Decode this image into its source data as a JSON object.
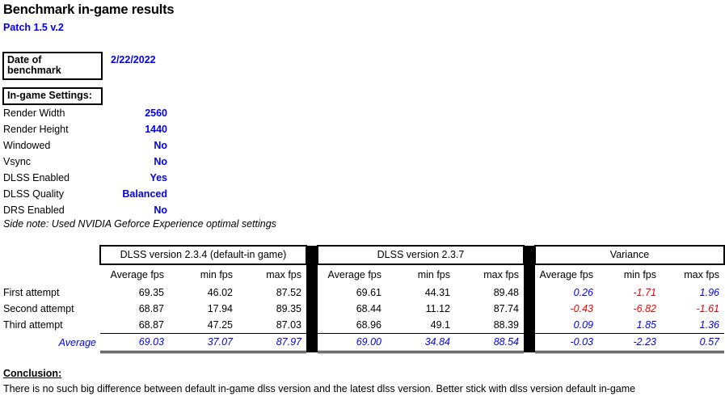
{
  "header": {
    "title": "Benchmark in-game results",
    "subtitle": "Patch 1.5 v.2"
  },
  "date": {
    "label": "Date of benchmark",
    "value": "2/22/2022"
  },
  "settings": {
    "heading": "In-game Settings:",
    "items": [
      {
        "name": "Render Width",
        "value": "2560"
      },
      {
        "name": "Render Height",
        "value": "1440"
      },
      {
        "name": "Windowed",
        "value": "No"
      },
      {
        "name": "Vsync",
        "value": "No"
      },
      {
        "name": "DLSS Enabled",
        "value": "Yes"
      },
      {
        "name": "DLSS Quality",
        "value": "Balanced"
      },
      {
        "name": "DRS Enabled",
        "value": "No"
      }
    ],
    "side_note": "Side note: Used NVIDIA Geforce Experience optimal settings"
  },
  "table": {
    "groups": [
      {
        "title": "DLSS version 2.3.4 (default-in game)"
      },
      {
        "title": "DLSS version 2.3.7"
      },
      {
        "title": "Variance"
      }
    ],
    "column_headers": [
      "Average fps",
      "min fps",
      "max fps"
    ],
    "row_labels": [
      "First attempt",
      "Second attempt",
      "Third attempt"
    ],
    "average_label": "Average",
    "dlss234": {
      "rows": [
        [
          "69.35",
          "46.02",
          "87.52"
        ],
        [
          "68.87",
          "17.94",
          "89.35"
        ],
        [
          "68.87",
          "47.25",
          "87.03"
        ]
      ],
      "average": [
        "69.03",
        "37.07",
        "87.97"
      ]
    },
    "dlss237": {
      "rows": [
        [
          "69.61",
          "44.31",
          "89.48"
        ],
        [
          "68.44",
          "11.12",
          "87.74"
        ],
        [
          "68.96",
          "49.1",
          "88.39"
        ]
      ],
      "average": [
        "69.00",
        "34.84",
        "88.54"
      ]
    },
    "variance": {
      "rows": [
        [
          "0.26",
          "-1.71",
          "1.96"
        ],
        [
          "-0.43",
          "-6.82",
          "-1.61"
        ],
        [
          "0.09",
          "1.85",
          "1.36"
        ]
      ],
      "average": [
        "-0.03",
        "-2.23",
        "0.57"
      ]
    }
  },
  "conclusion": {
    "title": "Conclusion:",
    "text": "There is no such big difference between default in-game dlss version and the latest dlss version. Better stick with dlss version default in-game"
  },
  "colors": {
    "accent_blue": "#0000ee",
    "negative_red": "#ee0000",
    "text_black": "#000000"
  }
}
